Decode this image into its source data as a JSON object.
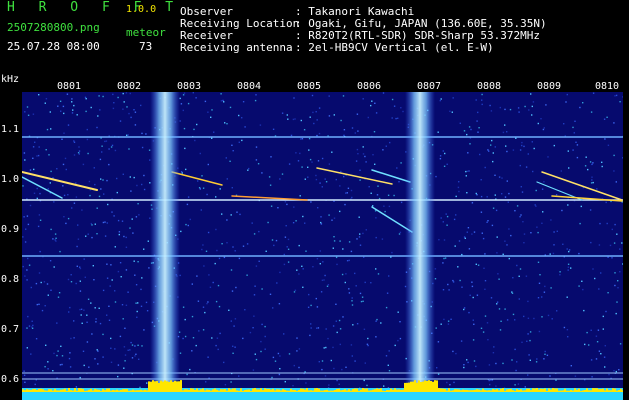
{
  "app": {
    "title": "H R O F F T",
    "version": "1.0.0",
    "filename": "2507280800.png",
    "datetime": "25.07.28 08:00",
    "meteor_label": "meteor",
    "meteor_count": "73"
  },
  "info": {
    "observer_label": "Observer",
    "observer_value": ": Takanori Kawachi",
    "location_label": "Receiving Location",
    "location_value": ": Ogaki, Gifu, JAPAN (136.60E, 35.35N)",
    "receiver_label": "Receiver",
    "receiver_value": ": R820T2(RTL-SDR) SDR-Sharp 53.372MHz",
    "antenna_label": "Receiving antenna",
    "antenna_value": ": 2el-HB9CV Vertical (el. E-W)"
  },
  "axes": {
    "y_unit": "kHz",
    "x_ticks": [
      "0801",
      "0802",
      "0803",
      "0804",
      "0805",
      "0806",
      "0807",
      "0808",
      "0809",
      "0810"
    ],
    "y_ticks": [
      "1.1",
      "1.0",
      "0.9",
      "0.8",
      "0.7",
      "0.6"
    ]
  },
  "colors": {
    "background": "#060a6e",
    "noise_band": "#9ed8ff",
    "carrier": "#6fb0ff",
    "bottom_bar": "#2ad6ff",
    "bottom_peak": "#ffe600",
    "header_green": "#3fe13f"
  }
}
